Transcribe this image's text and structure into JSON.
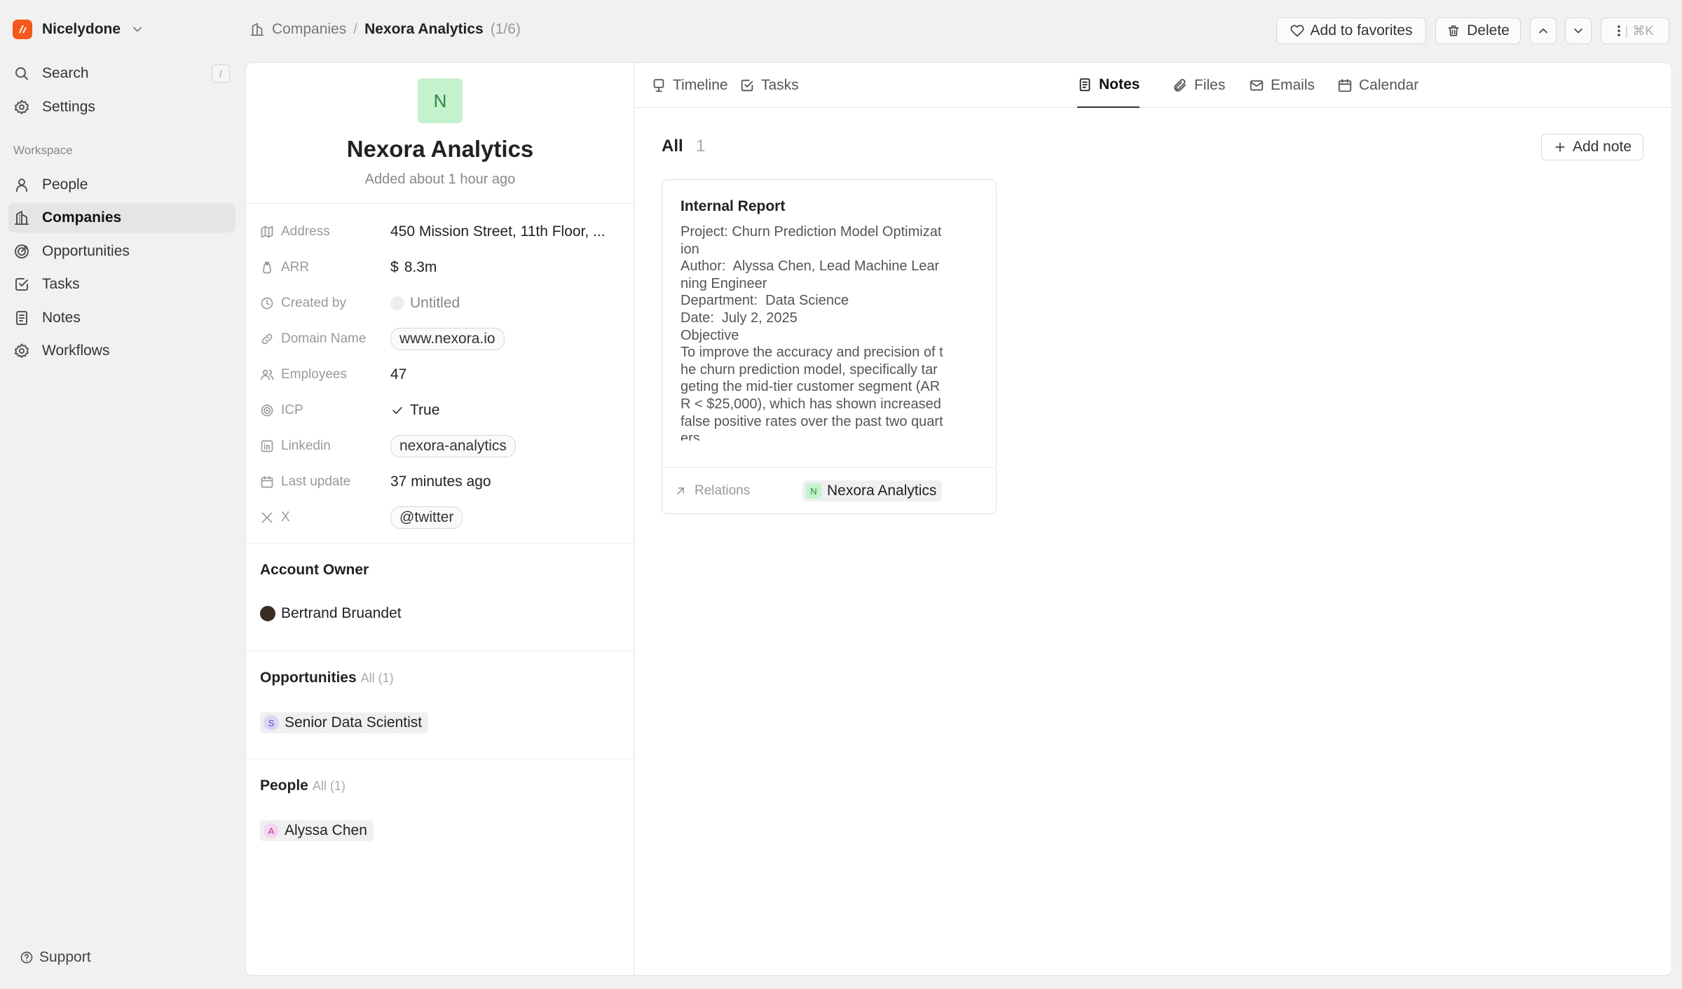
{
  "workspace": {
    "name": "Nicelydone",
    "logo_icon": "nicelydone-logo-icon",
    "accent": "#f4581c"
  },
  "sidebar": {
    "search_label": "Search",
    "search_shortcut": "/",
    "settings_label": "Settings",
    "section_label": "Workspace",
    "items": [
      {
        "label": "People",
        "icon": "person-icon"
      },
      {
        "label": "Companies",
        "icon": "building-icon",
        "active": true
      },
      {
        "label": "Opportunities",
        "icon": "target-icon"
      },
      {
        "label": "Tasks",
        "icon": "checkbox-icon"
      },
      {
        "label": "Notes",
        "icon": "notes-icon"
      },
      {
        "label": "Workflows",
        "icon": "gear-icon"
      }
    ],
    "support_label": "Support"
  },
  "breadcrumb": {
    "parent": "Companies",
    "separator": "/",
    "current": "Nexora Analytics",
    "position": "(1/6)"
  },
  "header_actions": {
    "favorites_label": "Add to favorites",
    "delete_label": "Delete",
    "more_shortcut": "⌘K"
  },
  "company": {
    "avatar_letter": "N",
    "name": "Nexora Analytics",
    "added": "Added about 1 hour ago",
    "fields": {
      "address": {
        "label": "Address",
        "value": "450 Mission Street, 11th Floor, ..."
      },
      "arr": {
        "label": "ARR",
        "value": "8.3m",
        "currency": "$"
      },
      "created_by": {
        "label": "Created by",
        "value": "Untitled"
      },
      "domain": {
        "label": "Domain Name",
        "value": "www.nexora.io"
      },
      "employees": {
        "label": "Employees",
        "value": "47"
      },
      "icp": {
        "label": "ICP",
        "value": "True"
      },
      "linkedin": {
        "label": "Linkedin",
        "value": "nexora-analytics"
      },
      "last_update": {
        "label": "Last update",
        "value": "37 minutes ago"
      },
      "x": {
        "label": "X",
        "value": "@twitter"
      }
    }
  },
  "account_owner": {
    "title": "Account Owner",
    "name": "Bertrand Bruandet"
  },
  "opportunities": {
    "title": "Opportunities",
    "sub": "All (1)",
    "items": [
      {
        "letter": "S",
        "name": "Senior Data Scientist"
      }
    ]
  },
  "people": {
    "title": "People",
    "sub": "All (1)",
    "items": [
      {
        "letter": "A",
        "name": "Alyssa Chen"
      }
    ]
  },
  "tabs": [
    {
      "label": "Timeline",
      "icon": "timeline-icon"
    },
    {
      "label": "Tasks",
      "icon": "checkbox-icon"
    },
    {
      "label": "Notes",
      "icon": "notes-icon",
      "active": true
    },
    {
      "label": "Files",
      "icon": "paperclip-icon"
    },
    {
      "label": "Emails",
      "icon": "mail-icon"
    },
    {
      "label": "Calendar",
      "icon": "calendar-icon"
    }
  ],
  "notes": {
    "all_label": "All",
    "count": "1",
    "add_label": "Add note",
    "items": [
      {
        "title": "Internal Report",
        "body": "Project: Churn Prediction Model Optimization\nAuthor:  Alyssa Chen, Lead Machine Learning Engineer\nDepartment:  Data Science\nDate:  July 2, 2025\nObjective\nTo improve the accuracy and precision of the churn prediction model, specifically targeting the mid-tier customer segment (ARR < $25,000), which has shown increased false positive rates over the past two quarters.",
        "relations_label": "Relations",
        "relation_letter": "N",
        "relation": "Nexora Analytics"
      }
    ]
  }
}
